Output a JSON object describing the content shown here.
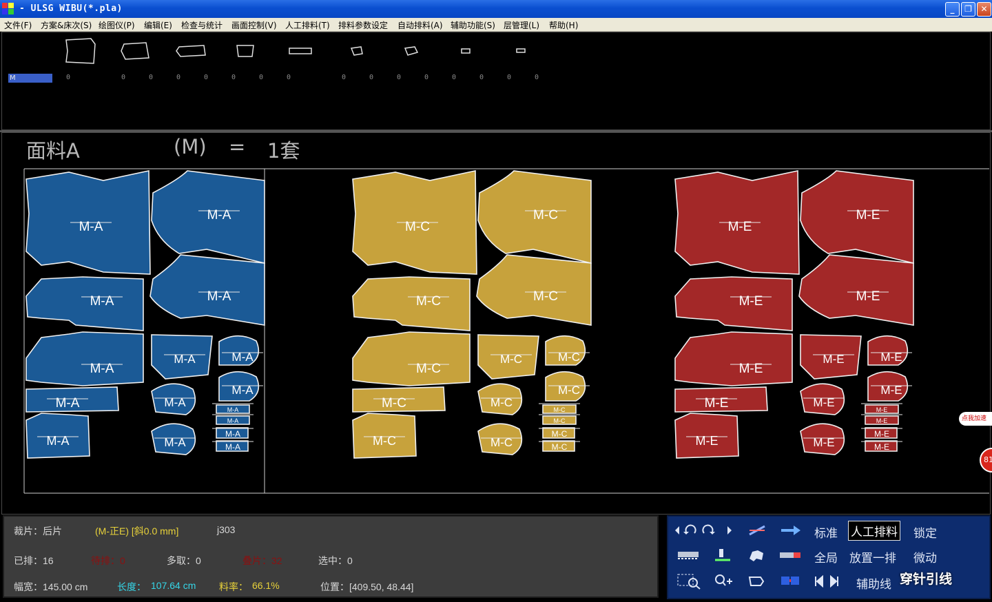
{
  "window": {
    "title": "- ULSG WIBU(*.pla)",
    "minimize_icon": "minimize-icon",
    "maximize_icon": "restore-icon",
    "close_icon": "close-icon"
  },
  "menu": [
    "文件(F)",
    "方案&床次(S)",
    "绘图仪(P)",
    "编辑(E)",
    "检查与统计",
    "画面控制(V)",
    "人工排料(T)",
    "排料参数设定",
    "自动排料(A)",
    "辅助功能(S)",
    "层管理(L)",
    "帮助(H)"
  ],
  "piece_list": {
    "size_label": "M",
    "counts": [
      "0",
      "0",
      "0",
      "0",
      "0",
      "0",
      "0",
      "0",
      "0",
      "0",
      "0",
      "0",
      "0",
      "0",
      "0",
      "0",
      "0",
      "0"
    ]
  },
  "layout": {
    "fabric": "面料A",
    "size": "(M)",
    "equals": "=",
    "sets": "1套",
    "piece_labels": {
      "blue": "M-A",
      "gold": "M-C",
      "red": "M-E"
    },
    "colors": {
      "blue": "#1b5a96",
      "gold": "#c7a23c",
      "red": "#a32828"
    }
  },
  "status": {
    "piece_label": "裁片：后片",
    "piece_info": "(M-正E) [斜0.0 mm]",
    "code": "j303",
    "placed": "已排：16",
    "unplaced": "待排：0",
    "extra": "多取：0",
    "overlap": "叠片：32",
    "selected": "选中：0",
    "width": "幅宽：145.00 cm",
    "length_label": "长度：",
    "length_value": "107.64 cm",
    "rate_label": "料率：",
    "rate_value": "66.1%",
    "position": "位置：[409.50, 48.44]"
  },
  "toolbar": {
    "standard": "标准",
    "manual": "人工排料",
    "lock": "锁定",
    "global": "全局",
    "place_row": "放置一排",
    "nudge": "微动",
    "guide": "辅助线"
  },
  "watermark": "穿针引线",
  "ad_badge": "点我加速",
  "ad_number": "81"
}
